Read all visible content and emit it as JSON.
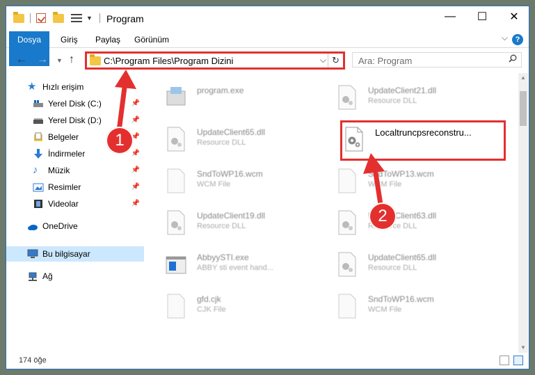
{
  "window": {
    "title": "Program",
    "controls": {
      "minimize": "—",
      "maximize": "☐",
      "close": "✕"
    }
  },
  "ribbon": {
    "tabs": [
      "Dosya",
      "Giriş",
      "Paylaş",
      "Görünüm"
    ]
  },
  "address": {
    "path": "C:\\Program Files\\Program Dizini",
    "search_placeholder": "Ara: Program"
  },
  "sidebar": {
    "items": [
      {
        "label": "Hızlı erişim",
        "icon": "star-icon"
      },
      {
        "label": "Yerel Disk (C:)",
        "icon": "drive-icon",
        "pinned": true
      },
      {
        "label": "Yerel Disk (D:)",
        "icon": "drive-icon",
        "pinned": true
      },
      {
        "label": "Belgeler",
        "icon": "documents-icon",
        "pinned": true
      },
      {
        "label": "İndirmeler",
        "icon": "download-icon",
        "pinned": true
      },
      {
        "label": "Müzik",
        "icon": "music-icon",
        "pinned": true
      },
      {
        "label": "Resimler",
        "icon": "pictures-icon",
        "pinned": true
      },
      {
        "label": "Videolar",
        "icon": "videos-icon",
        "pinned": true
      },
      {
        "label": "OneDrive",
        "icon": "cloud-icon"
      },
      {
        "label": "Bu bilgisayar",
        "icon": "computer-icon",
        "selected": true
      },
      {
        "label": "Ağ",
        "icon": "network-icon"
      }
    ]
  },
  "files": [
    {
      "name": "program.exe",
      "type": ""
    },
    {
      "name": "UpdateClient21.dll",
      "type": "Resource DLL"
    },
    {
      "name": "UpdateClient65.dll",
      "type": "Resource DLL"
    },
    {
      "name": "Localtruncpsreconstru...",
      "type": "",
      "highlighted": true
    },
    {
      "name": "SndToWP16.wcm",
      "type": "WCM File"
    },
    {
      "name": "SndToWP13.wcm",
      "type": "WCM File"
    },
    {
      "name": "UpdateClient19.dll",
      "type": "Resource DLL"
    },
    {
      "name": "UpdateClient63.dll",
      "type": "Resource DLL"
    },
    {
      "name": "AbbyySTI.exe",
      "type": "ABBY sti event hand..."
    },
    {
      "name": "UpdateClient65.dll",
      "type": "Resource DLL"
    },
    {
      "name": "gfd.cjk",
      "type": "CJK File"
    },
    {
      "name": "SndToWP16.wcm",
      "type": "WCM File"
    }
  ],
  "status": {
    "count": "174 öğe"
  },
  "markers": [
    "1",
    "2"
  ],
  "colors": {
    "accent": "#1979ca",
    "annotation": "#e3302f",
    "selected": "#cce8ff"
  }
}
